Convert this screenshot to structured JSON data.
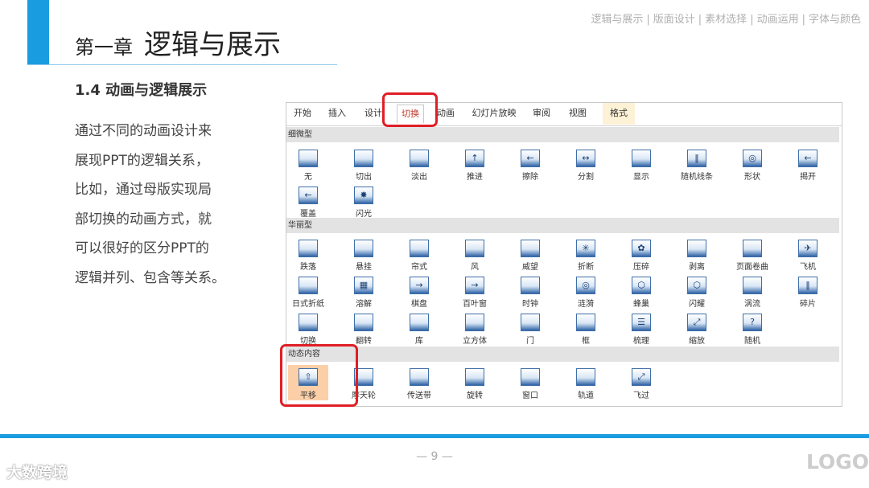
{
  "header": {
    "chapter_number": "第一章",
    "chapter_name": "逻辑与展示",
    "nav": [
      "逻辑与展示",
      "版面设计",
      "素材选择",
      "动画运用",
      "字体与颜色"
    ],
    "nav_separator": "|"
  },
  "section_title": "1.4 动画与逻辑展示",
  "body_lines": [
    "通过不同的动画设计来",
    "展现PPT的逻辑关系，",
    "比如，通过母版实现局",
    "部切换的动画方式，就",
    "可以很好的区分PPT的",
    "逻辑并列、包含等关系。"
  ],
  "ribbon": {
    "tabs": [
      "开始",
      "插入",
      "设计",
      "切换",
      "动画",
      "幻灯片放映",
      "审阅",
      "视图",
      "格式"
    ],
    "active_tab": "切换",
    "groups": [
      {
        "name": "细微型",
        "items": [
          {
            "label": "无",
            "icon": "none-icon",
            "glyph": ""
          },
          {
            "label": "切出",
            "icon": "cut-icon",
            "glyph": ""
          },
          {
            "label": "淡出",
            "icon": "fade-icon",
            "glyph": ""
          },
          {
            "label": "推进",
            "icon": "push-icon",
            "glyph": "↑"
          },
          {
            "label": "擦除",
            "icon": "wipe-icon",
            "glyph": "←"
          },
          {
            "label": "分割",
            "icon": "split-icon",
            "glyph": "↔"
          },
          {
            "label": "显示",
            "icon": "reveal-icon",
            "glyph": ""
          },
          {
            "label": "随机线条",
            "icon": "random-bars-icon",
            "glyph": "‖"
          },
          {
            "label": "形状",
            "icon": "shape-icon",
            "glyph": "◎"
          },
          {
            "label": "揭开",
            "icon": "uncover-icon",
            "glyph": "←"
          },
          {
            "label": "覆盖",
            "icon": "cover-icon",
            "glyph": "←"
          },
          {
            "label": "闪光",
            "icon": "flash-icon",
            "glyph": "✸"
          }
        ]
      },
      {
        "name": "华丽型",
        "items": [
          {
            "label": "跌落",
            "icon": "fall-over-icon",
            "glyph": ""
          },
          {
            "label": "悬挂",
            "icon": "drape-icon",
            "glyph": ""
          },
          {
            "label": "帘式",
            "icon": "curtains-icon",
            "glyph": ""
          },
          {
            "label": "风",
            "icon": "wind-icon",
            "glyph": ""
          },
          {
            "label": "威望",
            "icon": "prestige-icon",
            "glyph": ""
          },
          {
            "label": "折断",
            "icon": "fracture-icon",
            "glyph": "✳"
          },
          {
            "label": "压碎",
            "icon": "crush-icon",
            "glyph": "✿"
          },
          {
            "label": "剥离",
            "icon": "peel-off-icon",
            "glyph": ""
          },
          {
            "label": "页面卷曲",
            "icon": "page-curl-icon",
            "glyph": ""
          },
          {
            "label": "飞机",
            "icon": "airplane-icon",
            "glyph": "✈"
          },
          {
            "label": "日式折纸",
            "icon": "origami-icon",
            "glyph": ""
          },
          {
            "label": "溶解",
            "icon": "dissolve-icon",
            "glyph": "▦"
          },
          {
            "label": "棋盘",
            "icon": "checkerboard-icon",
            "glyph": "→"
          },
          {
            "label": "百叶窗",
            "icon": "blinds-icon",
            "glyph": "→"
          },
          {
            "label": "时钟",
            "icon": "clock-icon",
            "glyph": ""
          },
          {
            "label": "涟漪",
            "icon": "ripple-icon",
            "glyph": "◎"
          },
          {
            "label": "蜂巢",
            "icon": "honeycomb-icon",
            "glyph": "⬡"
          },
          {
            "label": "闪耀",
            "icon": "glitter-icon",
            "glyph": "⬡"
          },
          {
            "label": "涡流",
            "icon": "vortex-icon",
            "glyph": ""
          },
          {
            "label": "碎片",
            "icon": "shred-icon",
            "glyph": "‖"
          },
          {
            "label": "切换",
            "icon": "switch-icon",
            "glyph": ""
          },
          {
            "label": "翻转",
            "icon": "flip-icon",
            "glyph": ""
          },
          {
            "label": "库",
            "icon": "gallery-icon",
            "glyph": ""
          },
          {
            "label": "立方体",
            "icon": "cube-icon",
            "glyph": ""
          },
          {
            "label": "门",
            "icon": "doors-icon",
            "glyph": ""
          },
          {
            "label": "框",
            "icon": "box-icon",
            "glyph": ""
          },
          {
            "label": "梳理",
            "icon": "comb-icon",
            "glyph": "☰"
          },
          {
            "label": "缩放",
            "icon": "zoom-icon",
            "glyph": "⤢"
          },
          {
            "label": "随机",
            "icon": "random-icon",
            "glyph": "?"
          }
        ]
      },
      {
        "name": "动态内容",
        "items": [
          {
            "label": "平移",
            "icon": "pan-icon",
            "glyph": "⇧",
            "selected": true
          },
          {
            "label": "摩天轮",
            "icon": "ferris-wheel-icon",
            "glyph": ""
          },
          {
            "label": "传送带",
            "icon": "conveyor-icon",
            "glyph": ""
          },
          {
            "label": "旋转",
            "icon": "rotate-icon",
            "glyph": ""
          },
          {
            "label": "窗口",
            "icon": "window-icon",
            "glyph": ""
          },
          {
            "label": "轨道",
            "icon": "orbit-icon",
            "glyph": ""
          },
          {
            "label": "飞过",
            "icon": "fly-through-icon",
            "glyph": "⤢"
          }
        ]
      }
    ]
  },
  "page_number": "— 9 —",
  "logo": "LOGO",
  "watermark": "大数跨境",
  "colors": {
    "accent": "#1a9de0",
    "highlight": "#e01e25",
    "selected": "#fbcfa8"
  }
}
